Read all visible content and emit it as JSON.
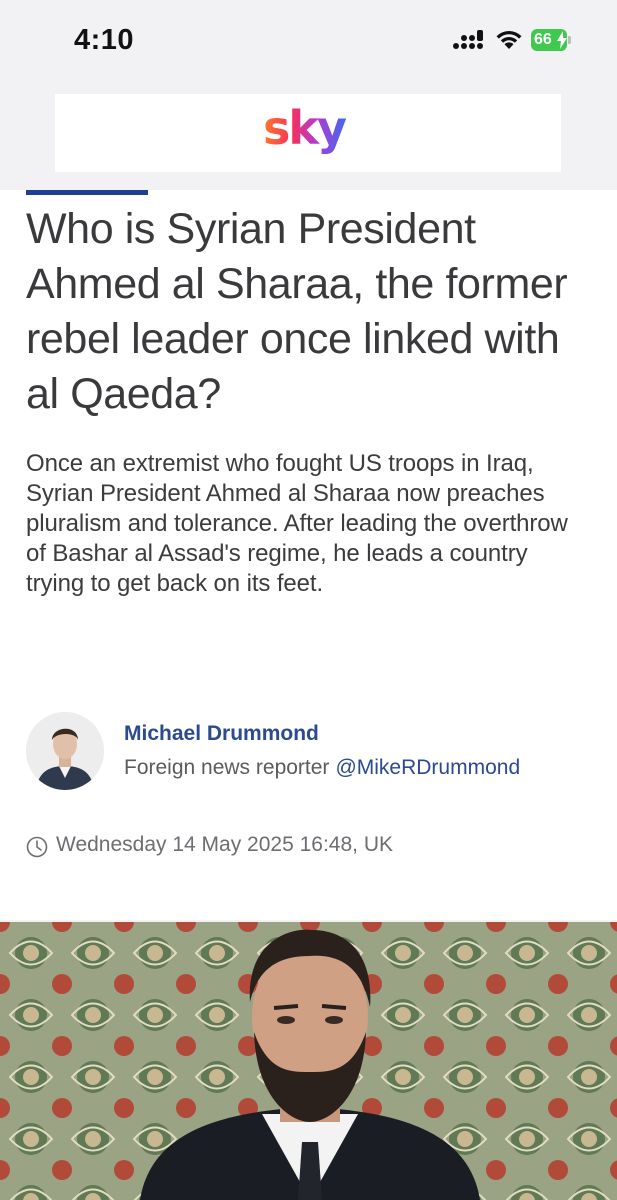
{
  "status_bar": {
    "time": "4:10",
    "battery_level": "66",
    "icons": [
      "cellular-signal-icon",
      "wifi-icon",
      "battery-icon",
      "charging-bolt-icon"
    ]
  },
  "header": {
    "logo_text": "sky"
  },
  "article": {
    "headline": "Who is Syrian President Ahmed al Sharaa, the former rebel leader once linked with al Qaeda?",
    "standfirst": "Once an extremist who fought US troops in Iraq, Syrian President Ahmed al Sharaa now preaches pluralism and tolerance. After leading the overthrow of Bashar al Assad's regime, he leads a country trying to get back on its feet.",
    "author": {
      "name": "Michael Drummond",
      "role": "Foreign news reporter",
      "handle": "@MikeRDrummond"
    },
    "timestamp": "Wednesday 14 May 2025 16:48, UK"
  },
  "colors": {
    "accent_blue": "#1f3f91",
    "link_blue": "#2b4a8f",
    "battery_green": "#3fc94e"
  }
}
